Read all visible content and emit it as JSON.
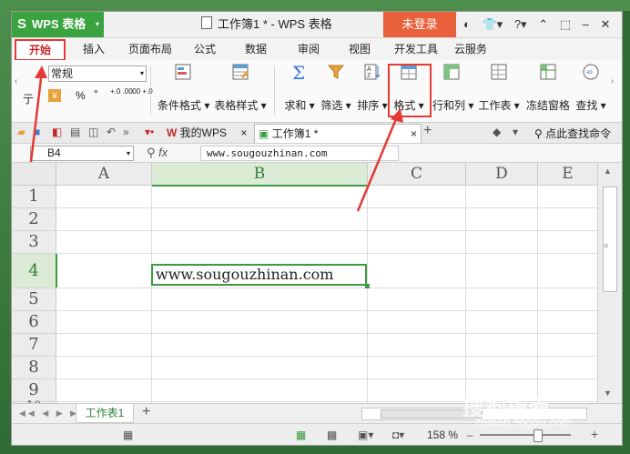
{
  "app": {
    "logo": "S",
    "name": "WPS 表格",
    "menu_arrow": "▾"
  },
  "title": "工作簿1 * - WPS 表格",
  "login_button": "未登录",
  "title_icons": [
    "◐",
    "👕▾",
    "?▾",
    "⌃",
    "⬚",
    "–",
    "✕"
  ],
  "ribbon_tabs": [
    "开始",
    "插入",
    "页面布局",
    "公式",
    "数据",
    "审阅",
    "视图",
    "开发工具",
    "云服务"
  ],
  "ribbon": {
    "number_format": "常规",
    "small_left": "亍",
    "percent": "%",
    "comma": "°",
    "inc_decimal": "+.0 .00",
    "dec_decimal": ".00 +.0",
    "cond_format": "条件格式",
    "table_style": "表格样式",
    "sum": "求和",
    "filter": "筛选",
    "sort": "排序",
    "format": "格式",
    "rowcol": "行和列",
    "worksheet": "工作表",
    "freeze": "冻结窗格",
    "find": "查找"
  },
  "doc_tabs": {
    "wps": "我的WPS",
    "workbook": "工作簿1 *",
    "close": "×",
    "add": "+"
  },
  "search_cmd": "点此查找命令",
  "name_box": "B4",
  "fx": "fx",
  "formula_value": "www.sougouzhinan.com",
  "columns": [
    "A",
    "B",
    "C",
    "D",
    "E"
  ],
  "rows": [
    "1",
    "2",
    "3",
    "4",
    "5",
    "6",
    "7",
    "8",
    "9",
    "10"
  ],
  "cell_value": "www.sougouzhinan.com",
  "sheet_tab": "工作表1",
  "zoom": "158 %",
  "watermark": "搜狗指南",
  "watermark_url": "zhinan.sogou.com",
  "colors": {
    "accent": "#3aa33f",
    "highlight": "#e53935",
    "login": "#e8613a"
  }
}
